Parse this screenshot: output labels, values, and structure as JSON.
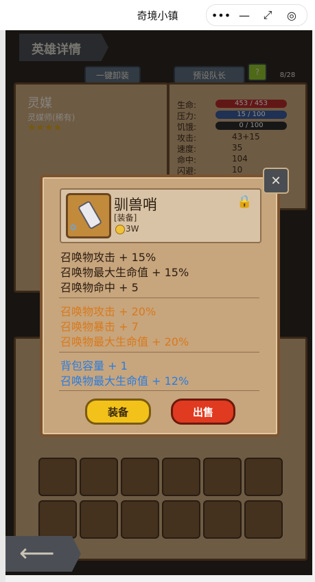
{
  "app": {
    "title": "奇境小镇",
    "capsule": {
      "more": "•••",
      "minimize": "—",
      "restore": "⤢",
      "close": "◎"
    }
  },
  "background": {
    "hero_header": "英雄详情",
    "tabs": [
      "一键卸装",
      "预设队长",
      "?",
      "8/28"
    ],
    "hero": {
      "name": "灵媒",
      "class": "灵媒师(稀有)",
      "stars": "★★★★"
    },
    "stats": [
      {
        "label": "生命:",
        "value": "453 / 453"
      },
      {
        "label": "压力:",
        "value": "15 / 100"
      },
      {
        "label": "饥饿:",
        "value": "0 / 100"
      },
      {
        "label": "攻击:",
        "value": "43+15"
      },
      {
        "label": "速度:",
        "value": "35"
      },
      {
        "label": "命中:",
        "value": "104"
      },
      {
        "label": "闪避:",
        "value": "10"
      }
    ],
    "colors": {
      "hp": "#b22a2a",
      "stress": "#3a5a9a",
      "hunger": "#2a2a2a"
    }
  },
  "modal": {
    "item": {
      "name": "驯兽哨",
      "type": "[装备]",
      "price": "3W",
      "locked": true
    },
    "base_attrs": [
      "召唤物攻击 + 15%",
      "召唤物最大生命值 + 15%",
      "召唤物命中 + 5"
    ],
    "orange_attrs": [
      "召唤物攻击 + 20%",
      "召唤物暴击 + 7",
      "召唤物最大生命值 + 20%"
    ],
    "blue_attrs": [
      "背包容量 + 1",
      "召唤物最大生命值 + 12%"
    ],
    "buttons": {
      "equip": "装备",
      "sell": "出售"
    },
    "colors": {
      "orange": "#d87a1c",
      "blue": "#2a7de0",
      "equip_button": "#f2c21a",
      "sell_button": "#e03a20"
    }
  }
}
